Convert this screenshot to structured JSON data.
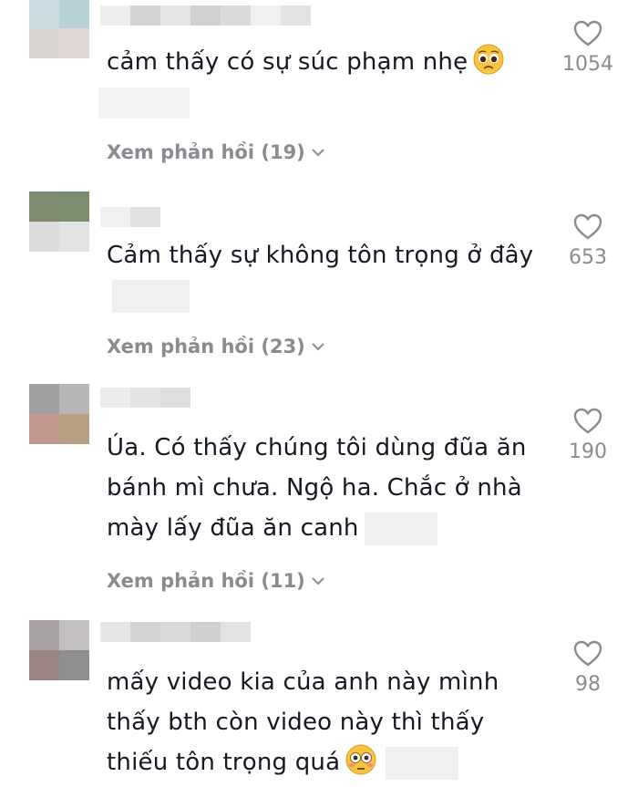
{
  "comments": [
    {
      "text": "cảm thấy có sự súc phạm nhẹ",
      "emoji": "pleading-face",
      "replies_label": "Xem phản hồi (19)",
      "likes": "1054"
    },
    {
      "text": "Cảm thấy sự không tôn trọng ở đây",
      "replies_label": "Xem phản hồi (23)",
      "likes": "653"
    },
    {
      "text": "Úa. Có thấy chúng tôi dùng đũa ăn bánh mì chưa. Ngộ ha. Chắc ở nhà mày lấy đũa ăn canh",
      "replies_label": "Xem phản hồi (11)",
      "likes": "190"
    },
    {
      "text": "mấy video kia của anh này mình thấy bth còn video này thì thấy thiếu tôn trọng quá",
      "emoji": "flushed-face",
      "likes": "98"
    }
  ],
  "colors": {
    "text": "#161823",
    "muted": "#8a8b91",
    "emoji_face": "#f7c442"
  }
}
